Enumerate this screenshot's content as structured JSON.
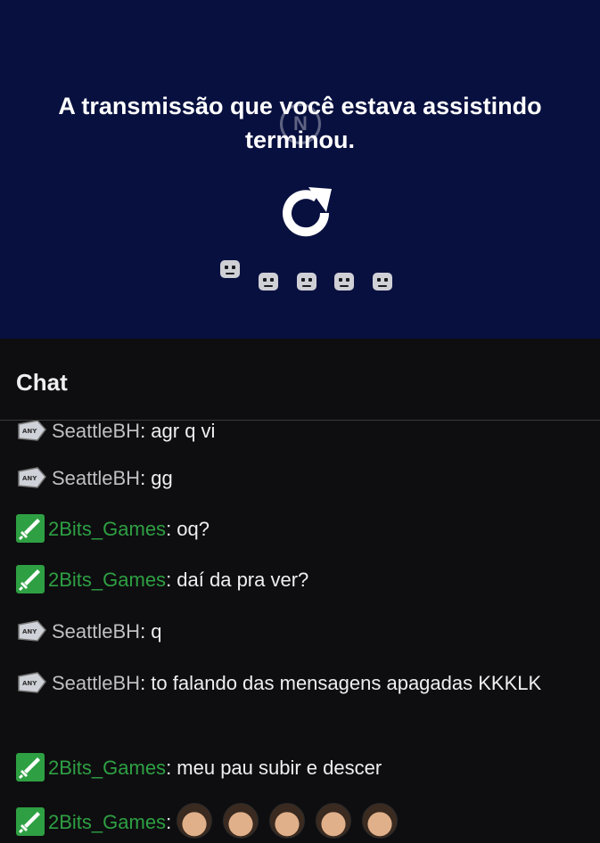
{
  "player": {
    "ended_message": "A transmissão que você estava assistindo terminou.",
    "reload_icon": "reload-icon",
    "watermark_icon": "channel-logo-watermark",
    "background": "#08103f"
  },
  "chat": {
    "header": "Chat",
    "messages": [
      {
        "user": "SeattleBH",
        "text": ": agr q vi",
        "user_color": "#bfbfc4",
        "badge": "prime-badge"
      },
      {
        "user": "SeattleBH",
        "text": ": gg",
        "user_color": "#bfbfc4",
        "badge": "prime-badge"
      },
      {
        "user": "2Bits_Games",
        "text": ": oq?",
        "user_color": "#2ea043",
        "badge": "moderator-sword-badge"
      },
      {
        "user": "2Bits_Games",
        "text": ": daí da pra ver?",
        "user_color": "#2ea043",
        "badge": "moderator-sword-badge"
      },
      {
        "user": "SeattleBH",
        "text": ": q",
        "user_color": "#bfbfc4",
        "badge": "prime-badge"
      },
      {
        "user": "SeattleBH",
        "text": ": to falando das mensagens apagadas KKKLK",
        "user_color": "#bfbfc4",
        "badge": "prime-badge"
      },
      {
        "user": "2Bits_Games",
        "text": ": meu pau subir e descer",
        "user_color": "#2ea043",
        "badge": "moderator-sword-badge"
      },
      {
        "user": "2Bits_Games",
        "text": ":",
        "user_color": "#2ea043",
        "badge": "moderator-sword-badge",
        "emotes": [
          "face-emote",
          "face-emote",
          "face-emote",
          "face-emote",
          "face-emote"
        ]
      }
    ]
  },
  "colors": {
    "chat_bg": "#0e0e10",
    "moderator_green": "#2ea043",
    "text": "#efeff1"
  }
}
